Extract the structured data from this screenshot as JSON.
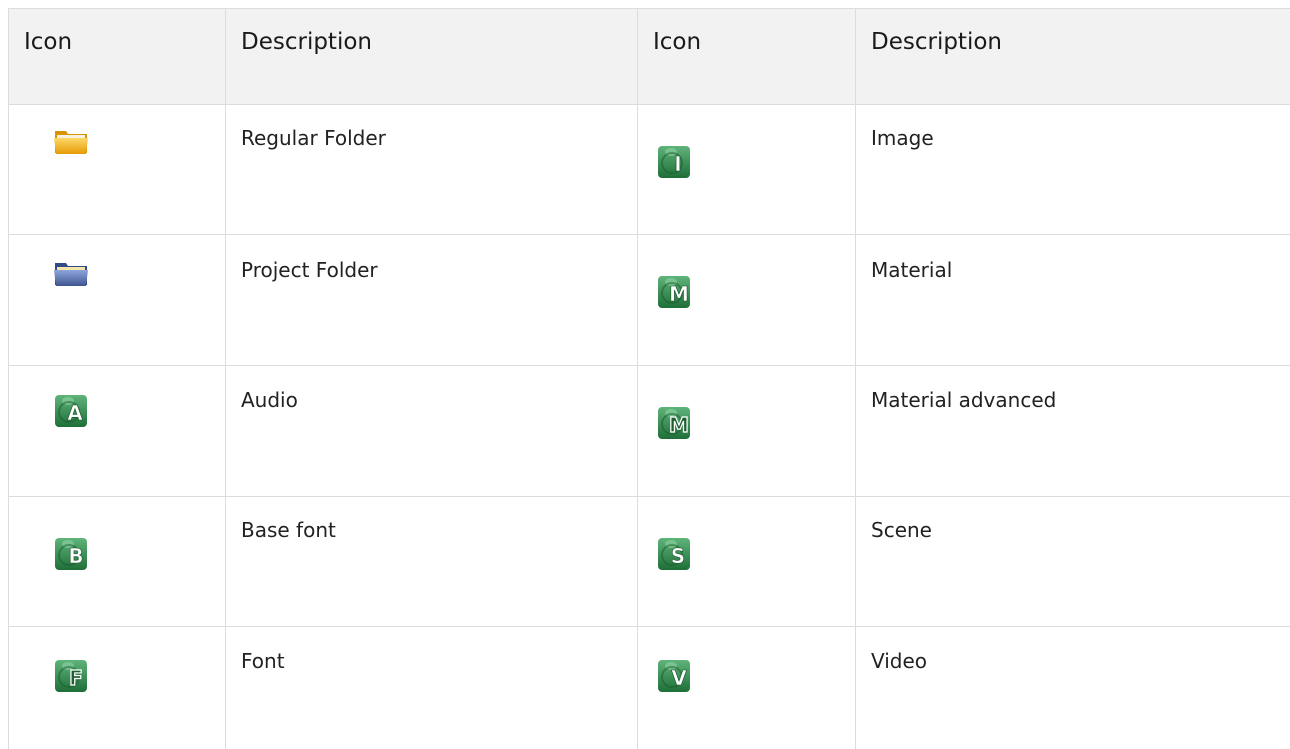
{
  "headers": [
    "Icon",
    "Description",
    "Icon",
    "Description"
  ],
  "rows": [
    {
      "left": {
        "icon": "regular-folder-icon",
        "letter": "",
        "label": "Regular Folder"
      },
      "right": {
        "icon": "image-icon",
        "letter": "I",
        "label": "Image"
      }
    },
    {
      "left": {
        "icon": "project-folder-icon",
        "letter": "",
        "label": "Project Folder"
      },
      "right": {
        "icon": "material-icon",
        "letter": "M",
        "label": "Material"
      }
    },
    {
      "left": {
        "icon": "audio-icon",
        "letter": "A",
        "label": "Audio"
      },
      "right": {
        "icon": "material-advanced-icon",
        "letter": "M",
        "label": "Material advanced"
      }
    },
    {
      "left": {
        "icon": "base-font-icon",
        "letter": "B",
        "label": "Base font"
      },
      "right": {
        "icon": "scene-icon",
        "letter": "S",
        "label": "Scene"
      }
    },
    {
      "left": {
        "icon": "font-icon",
        "letter": "F",
        "label": "Font"
      },
      "right": {
        "icon": "video-icon",
        "letter": "V",
        "label": "Video"
      }
    }
  ],
  "colors": {
    "header_bg": "#f2f2f2",
    "grid": "#dcdcdc",
    "icon_green": "#2e8a4a",
    "regular_folder": "#f2b316",
    "project_folder": "#5b73b0"
  }
}
